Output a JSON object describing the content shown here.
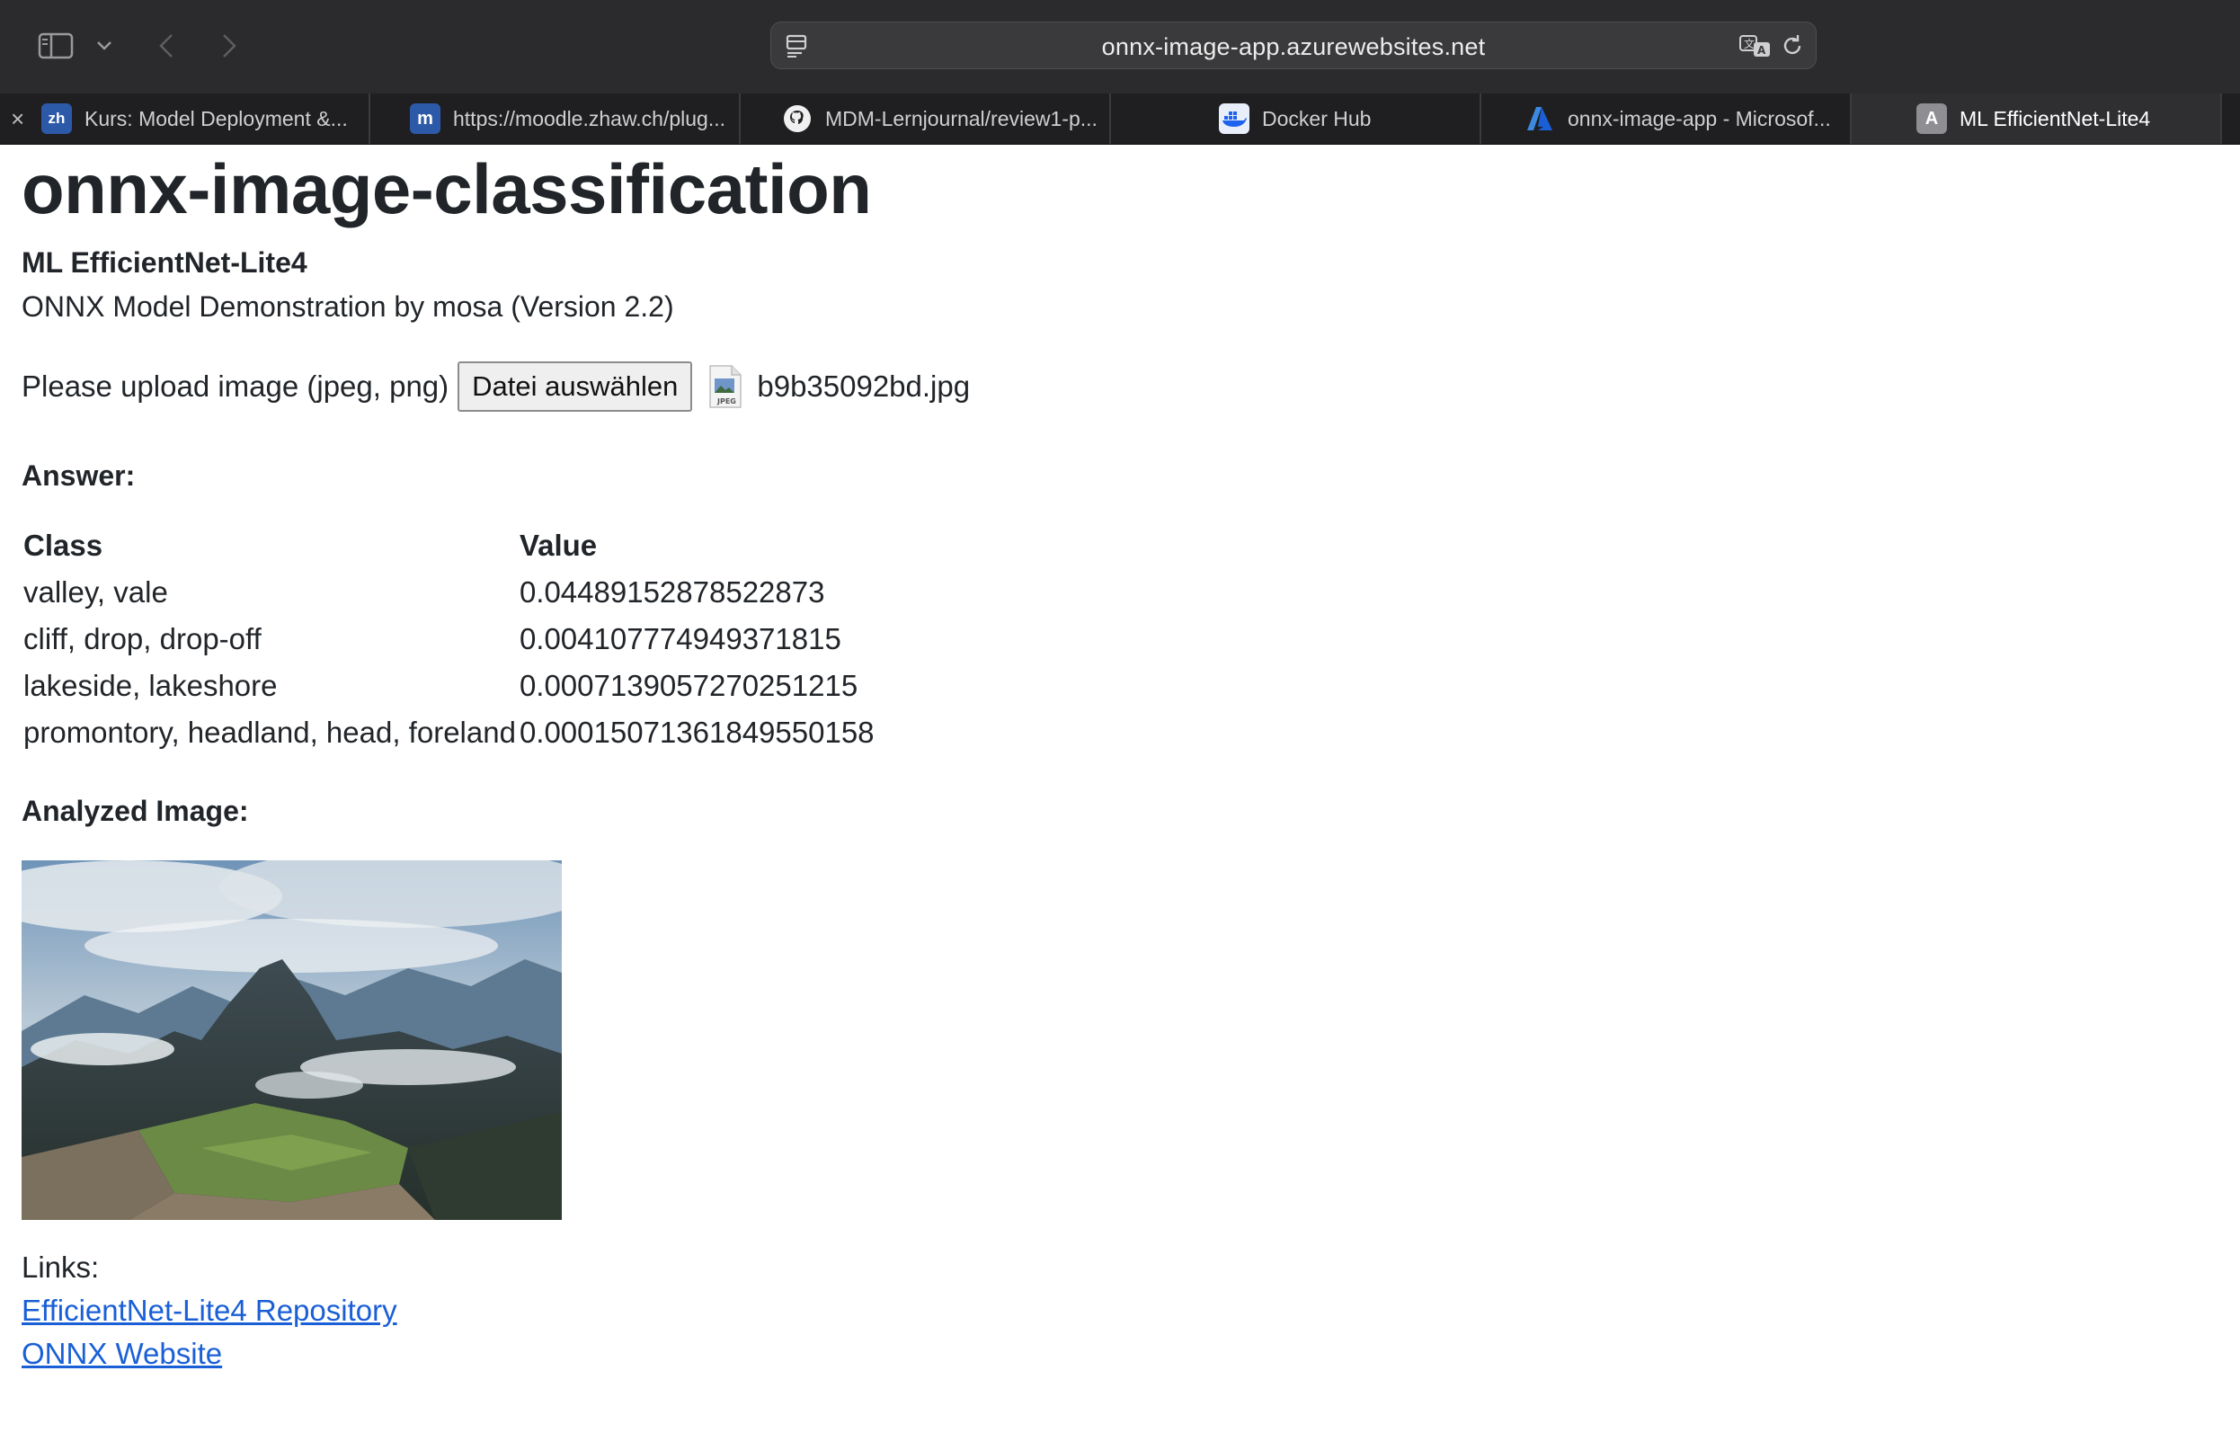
{
  "browser": {
    "address": "onnx-image-app.azurewebsites.net",
    "tabs": [
      {
        "label": "Kurs: Model Deployment &...",
        "icon": "zhaw-logo-icon"
      },
      {
        "label": "https://moodle.zhaw.ch/plug...",
        "icon": "moodle-logo-icon"
      },
      {
        "label": "MDM-Lernjournal/review1-p...",
        "icon": "github-logo-icon"
      },
      {
        "label": "Docker Hub",
        "icon": "docker-logo-icon"
      },
      {
        "label": "onnx-image-app - Microsof...",
        "icon": "azure-logo-icon"
      },
      {
        "label": "ML EfficientNet-Lite4",
        "icon": "letter-a-icon",
        "active": true
      }
    ]
  },
  "page": {
    "title": "onnx-image-classification",
    "model_name": "ML EfficientNet-Lite4",
    "subtitle": "ONNX Model Demonstration by mosa (Version 2.2)",
    "upload_label": "Please upload image (jpeg, png)",
    "file_button": "Datei auswählen",
    "file_name": "b9b35092bd.jpg",
    "answer_heading": "Answer:",
    "table": {
      "headers": [
        "Class",
        "Value"
      ],
      "rows": [
        [
          "valley, vale",
          "0.04489152878522873"
        ],
        [
          "cliff, drop, drop-off",
          "0.004107774949371815"
        ],
        [
          "lakeside, lakeshore",
          "0.0007139057270251215"
        ],
        [
          "promontory, headland, head, foreland",
          "0.00015071361849550158"
        ]
      ]
    },
    "analyzed_heading": "Analyzed Image:",
    "links_label": "Links:",
    "links": [
      "EfficientNet-Lite4 Repository",
      "ONNX Website"
    ]
  },
  "colors": {
    "toolbar_bg": "#2b2b2d",
    "tabbar_bg": "#1f1f21",
    "link": "#1a5fd6",
    "text": "#212529"
  }
}
